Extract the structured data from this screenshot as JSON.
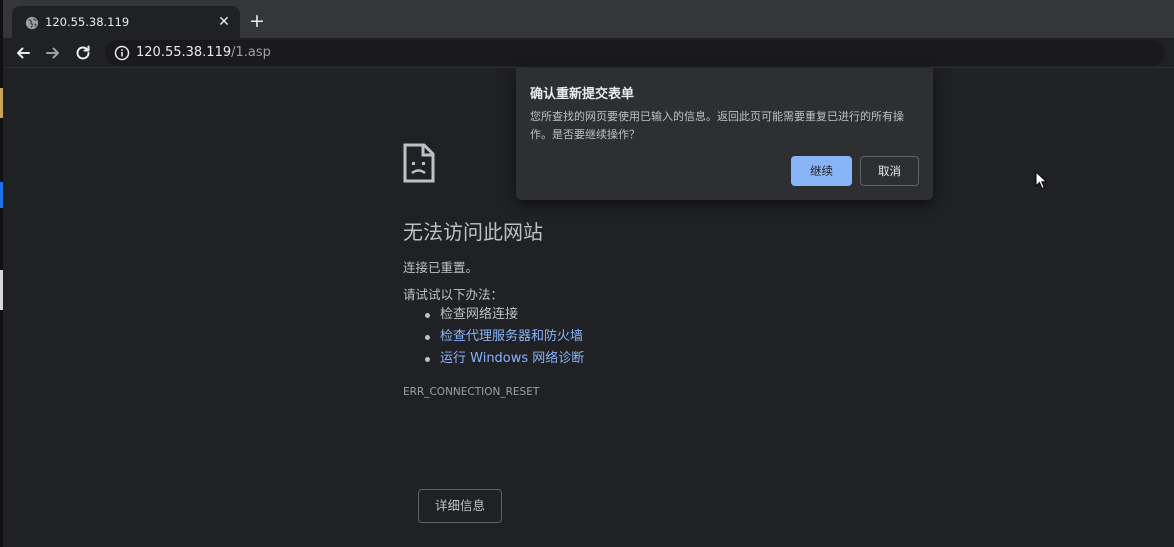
{
  "tab": {
    "title": "120.55.38.119",
    "close": "✕",
    "new_tab": "+"
  },
  "address_bar": {
    "host": "120.55.38.119",
    "path": "/1.asp"
  },
  "error_page": {
    "title": "无法访问此网站",
    "subtitle": "连接已重置。",
    "try_label": "请试试以下办法：",
    "suggestions": [
      {
        "text": "检查网络连接",
        "is_link": false
      },
      {
        "text": "检查代理服务器和防火墙",
        "is_link": true
      },
      {
        "text": "运行 Windows 网络诊断",
        "is_link": true
      }
    ],
    "error_code": "ERR_CONNECTION_RESET",
    "details_button": "详细信息"
  },
  "dialog": {
    "title": "确认重新提交表单",
    "body": "您所查找的网页要使用已输入的信息。返回此页可能需要重复已进行的所有操作。是否要继续操作？",
    "continue_label": "继续",
    "cancel_label": "取消"
  },
  "icons": {
    "favicon": "globe-icon",
    "back": "arrow-left-icon",
    "forward": "arrow-right-icon",
    "reload": "reload-icon",
    "info": "info-icon",
    "error": "sad-page-icon",
    "cursor": "mouse-cursor-icon"
  },
  "colors": {
    "link": "#8ab4f8",
    "primary_button": "#8ab4f8",
    "background": "#202124"
  }
}
